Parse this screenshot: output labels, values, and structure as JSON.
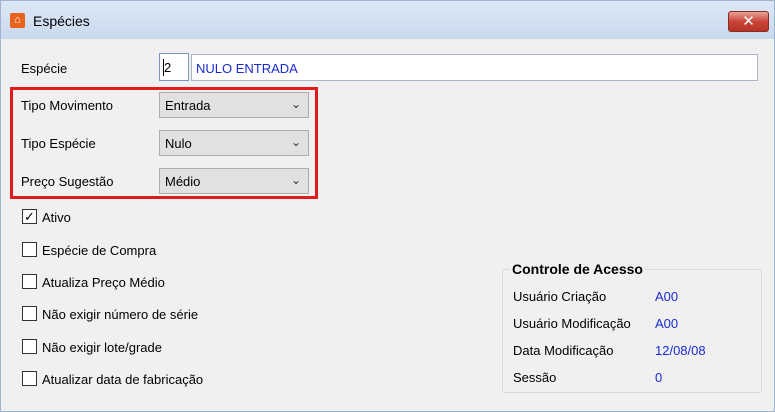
{
  "window": {
    "title": "Espécies",
    "close_glyph": "✕"
  },
  "form": {
    "especie_label": "Espécie",
    "especie_code": "2",
    "especie_desc": "NULO ENTRADA",
    "tipo_movimento_label": "Tipo Movimento",
    "tipo_movimento_value": "Entrada",
    "tipo_especie_label": "Tipo Espécie",
    "tipo_especie_value": "Nulo",
    "preco_sugestao_label": "Preço Sugestão",
    "preco_sugestao_value": "Médio"
  },
  "checkboxes": [
    {
      "label": "Ativo",
      "checked": true
    },
    {
      "label": "Espécie de Compra",
      "checked": false
    },
    {
      "label": "Atualiza Preço Médio",
      "checked": false
    },
    {
      "label": "Não exigir número de série",
      "checked": false
    },
    {
      "label": "Não exigir lote/grade",
      "checked": false
    },
    {
      "label": "Atualizar data de fabricação",
      "checked": false
    }
  ],
  "access": {
    "title": "Controle de Acesso",
    "rows": [
      {
        "label": "Usuário Criação",
        "value": "A00"
      },
      {
        "label": "Usuário Modificação",
        "value": "A00"
      },
      {
        "label": "Data Modificação",
        "value": "12/08/08"
      },
      {
        "label": "Sessão",
        "value": "0"
      }
    ]
  },
  "icons": {
    "dropdown": "chevron-down-icon",
    "check": "check-icon",
    "app": "app-icon"
  },
  "colors": {
    "value_blue": "#1a2bd1",
    "highlight_red": "#e01b1b",
    "close_red": "#c9453a"
  }
}
